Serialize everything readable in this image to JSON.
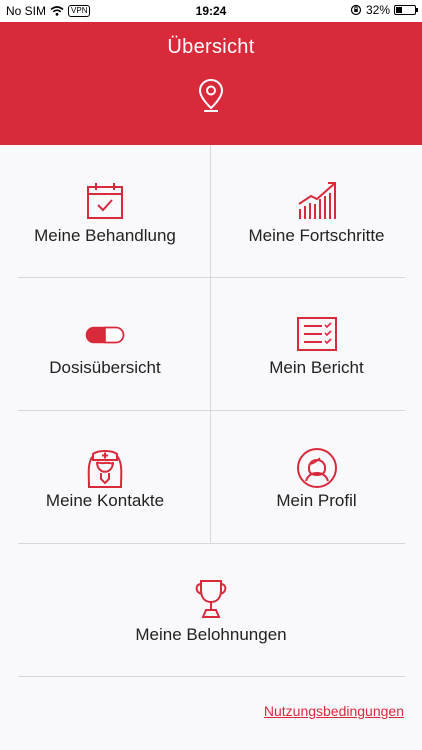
{
  "status_bar": {
    "carrier": "No SIM",
    "vpn": "VPN",
    "time": "19:24",
    "battery": "32%",
    "battery_level": 0.32
  },
  "header": {
    "title": "Übersicht",
    "background_color": "#d92a3c",
    "icon": "location-pin-icon"
  },
  "tiles": [
    {
      "label": "Meine Behandlung",
      "icon": "calendar-check-icon"
    },
    {
      "label": "Meine Fortschritte",
      "icon": "bar-chart-trend-icon"
    },
    {
      "label": "Dosisübersicht",
      "icon": "pill-icon"
    },
    {
      "label": "Mein Bericht",
      "icon": "checklist-report-icon"
    },
    {
      "label": "Meine Kontakte",
      "icon": "nurse-icon"
    },
    {
      "label": "Mein Profil",
      "icon": "profile-icon"
    },
    {
      "label": "Meine Belohnungen",
      "icon": "trophy-icon"
    }
  ],
  "footer": {
    "terms_link": "Nutzungsbedingungen"
  },
  "accent_color": "#d92a3c"
}
